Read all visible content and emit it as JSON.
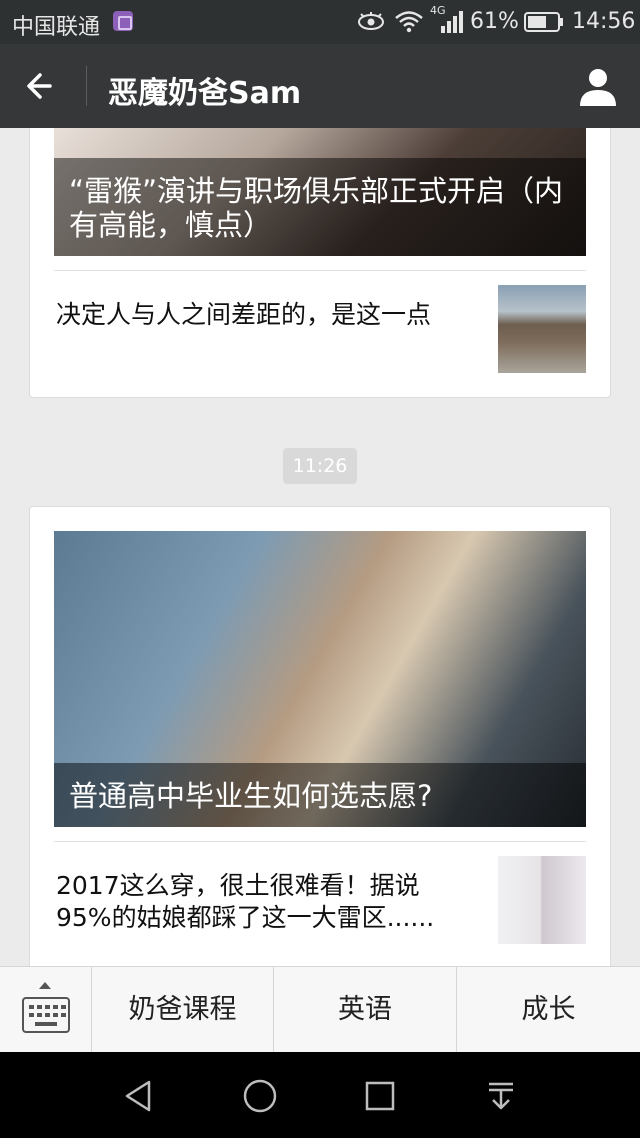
{
  "status_bar": {
    "carrier": "中国联通",
    "net_type": "4G",
    "battery_percent": "61%",
    "time": "14:56",
    "icons": [
      "sim-icon",
      "eye-icon",
      "wifi-icon",
      "signal-icon",
      "battery-icon"
    ]
  },
  "header": {
    "title": "恶魔奶爸Sam",
    "back_icon": "back-arrow-icon",
    "profile_icon": "profile-icon"
  },
  "messages": [
    {
      "cover": {
        "title": "“雷猴”演讲与职场俱乐部正式开启（内有高能，慎点）"
      },
      "items": [
        {
          "title": "决定人与人之间差距的，是这一点",
          "thumb": "buildings-thumbnail"
        }
      ]
    },
    {
      "timestamp": "11:26",
      "cover": {
        "title": "普通高中毕业生如何选志愿?"
      },
      "items": [
        {
          "title": "2017这么穿，很土很难看！据说95%的姑娘都踩了这一大雷区......",
          "thumb": "fashion-thumbnail"
        }
      ]
    }
  ],
  "menu": {
    "keyboard_icon": "keyboard-icon",
    "items": [
      "奶爸课程",
      "英语",
      "成长"
    ]
  },
  "nav_bar": {
    "icons": [
      "back-triangle-icon",
      "home-circle-icon",
      "recent-square-icon",
      "notification-pulldown-icon"
    ]
  }
}
